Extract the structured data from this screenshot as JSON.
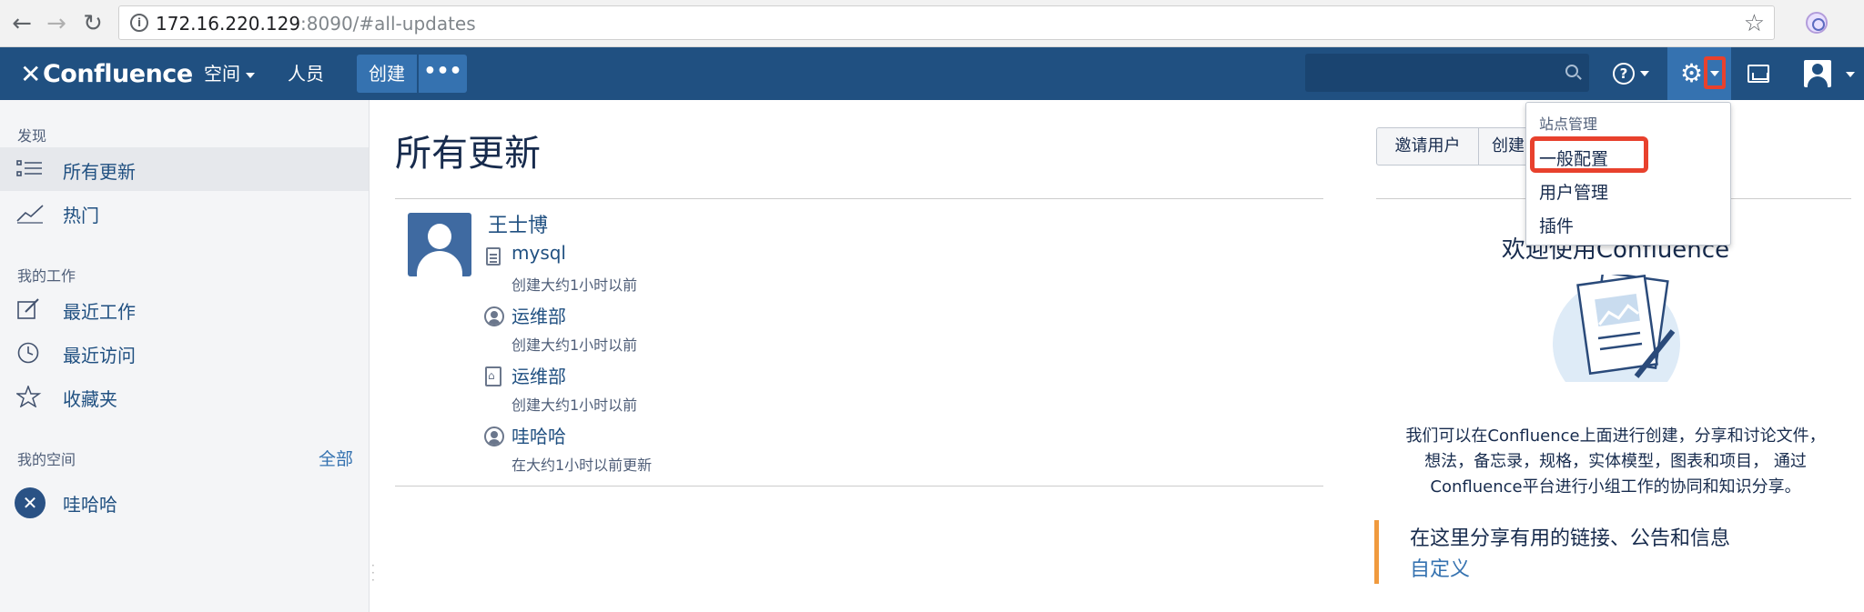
{
  "browser": {
    "url_host": "172.16.220.129",
    "url_path": ":8090/#all-updates"
  },
  "header": {
    "logo_text": "Confluence",
    "nav_spaces": "空间",
    "nav_people": "人员",
    "create_label": "创建",
    "more_label": "•••",
    "help_symbol": "?"
  },
  "sidebar": {
    "discover_heading": "发现",
    "discover_items": [
      {
        "label": "所有更新",
        "icon": "list-icon",
        "active": true
      },
      {
        "label": "热门",
        "icon": "trend-icon"
      }
    ],
    "my_work_heading": "我的工作",
    "my_work_items": [
      {
        "label": "最近工作",
        "icon": "edit-icon"
      },
      {
        "label": "最近访问",
        "icon": "clock-icon"
      },
      {
        "label": "收藏夹",
        "icon": "star-icon"
      }
    ],
    "my_spaces_heading": "我的空间",
    "all_link": "全部",
    "spaces": [
      {
        "label": "哇哈哈",
        "icon": "space-logo-icon"
      }
    ]
  },
  "main": {
    "title": "所有更新",
    "user_name": "王士博",
    "feed": [
      {
        "title": "mysql",
        "meta": "创建大约1小时以前",
        "icon": "page-icon"
      },
      {
        "title": "运维部",
        "meta": "创建大约1小时以前",
        "icon": "person-icon"
      },
      {
        "title": "运维部",
        "meta": "创建大约1小时以前",
        "icon": "home-page-icon"
      },
      {
        "title": "哇哈哈",
        "meta": "在大约1小时以前更新",
        "icon": "person-icon"
      }
    ]
  },
  "right": {
    "invite_label": "邀请用户",
    "create_space_label": "创建",
    "welcome_title": "欢迎使用Confluence",
    "welcome_lines": [
      "我们可以在Confluence上面进行创建，分享和讨论文件，",
      "想法，备忘录，规格，实体模型，图表和项目， 通过",
      "Confluence平台进行小组工作的协同和知识分享。"
    ],
    "share_text": "在这里分享有用的链接、公告和信息",
    "customize_link": "自定义"
  },
  "dropdown": {
    "heading": "站点管理",
    "items": [
      "一般配置",
      "用户管理",
      "插件"
    ]
  },
  "colors": {
    "header_bg": "#205081",
    "accent": "#3572b0",
    "highlight": "#e8412d",
    "share_border": "#f09a3e"
  }
}
